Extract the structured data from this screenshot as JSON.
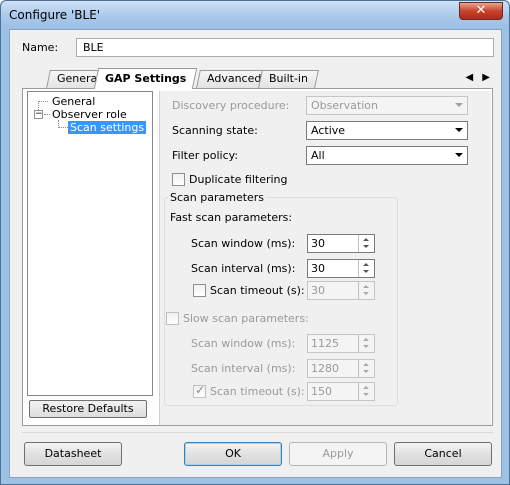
{
  "window": {
    "title": "Configure 'BLE'"
  },
  "name": {
    "label": "Name:",
    "value": "BLE"
  },
  "tabs": [
    {
      "label": "General"
    },
    {
      "label": "GAP Settings"
    },
    {
      "label": "Advanced"
    },
    {
      "label": "Built-in"
    }
  ],
  "tab_arrows": "◀ ▶",
  "tree": {
    "items": [
      {
        "label": "General"
      },
      {
        "label": "Observer role"
      },
      {
        "label": "Scan settings"
      }
    ]
  },
  "restore_defaults": "Restore Defaults",
  "settings": {
    "discovery_procedure": {
      "label": "Discovery procedure:",
      "value": "Observation"
    },
    "scanning_state": {
      "label": "Scanning state:",
      "value": "Active"
    },
    "filter_policy": {
      "label": "Filter policy:",
      "value": "All"
    },
    "duplicate_filtering": {
      "label": "Duplicate filtering"
    },
    "scan_parameters": {
      "title": "Scan parameters",
      "fast_title": "Fast scan parameters:",
      "fast": {
        "window": {
          "label": "Scan window (ms):",
          "value": "30"
        },
        "interval": {
          "label": "Scan interval (ms):",
          "value": "30"
        },
        "timeout": {
          "label": "Scan timeout (s):",
          "value": "30"
        }
      },
      "slow_title": "Slow scan parameters:",
      "slow": {
        "window": {
          "label": "Scan window (ms):",
          "value": "1125"
        },
        "interval": {
          "label": "Scan interval (ms):",
          "value": "1280"
        },
        "timeout": {
          "label": "Scan timeout (s):",
          "value": "150"
        }
      }
    }
  },
  "buttons": {
    "datasheet": "Datasheet",
    "ok": "OK",
    "apply": "Apply",
    "cancel": "Cancel"
  }
}
